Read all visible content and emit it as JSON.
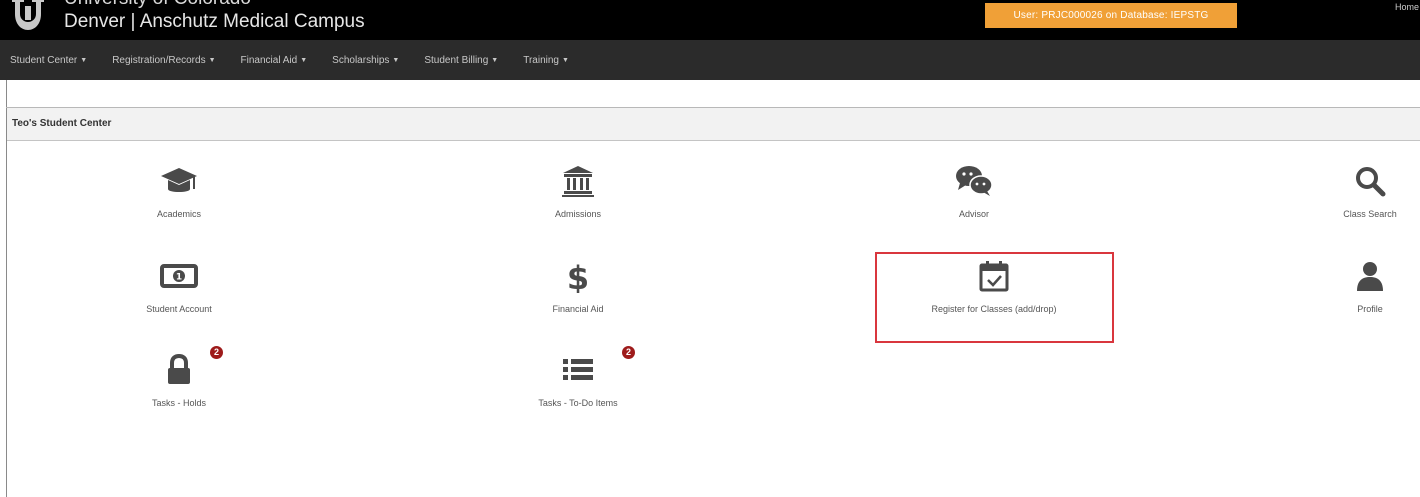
{
  "header": {
    "university_line1": "University of Colorado",
    "university_line2": "Denver | Anschutz Medical Campus",
    "user_badge": "User: PRJC000026 on Database: IEPSTG",
    "home_link": "Home"
  },
  "nav": {
    "items": [
      {
        "label": "Student Center"
      },
      {
        "label": "Registration/Records"
      },
      {
        "label": "Financial Aid"
      },
      {
        "label": "Scholarships"
      },
      {
        "label": "Student Billing"
      },
      {
        "label": "Training"
      }
    ]
  },
  "section": {
    "title": "Teo's Student Center"
  },
  "tiles": {
    "academics": {
      "label": "Academics",
      "icon": "graduation-cap-icon"
    },
    "admissions": {
      "label": "Admissions",
      "icon": "institution-icon"
    },
    "advisor": {
      "label": "Advisor",
      "icon": "chat-bubbles-icon"
    },
    "class_search": {
      "label": "Class Search",
      "icon": "search-icon"
    },
    "student_account": {
      "label": "Student Account",
      "icon": "money-icon"
    },
    "financial_aid": {
      "label": "Financial Aid",
      "icon": "dollar-icon"
    },
    "register": {
      "label": "Register for Classes (add/drop)",
      "icon": "calendar-check-icon"
    },
    "profile": {
      "label": "Profile",
      "icon": "user-icon"
    },
    "tasks_holds": {
      "label": "Tasks - Holds",
      "icon": "lock-icon",
      "badge": "2"
    },
    "tasks_todo": {
      "label": "Tasks - To-Do Items",
      "icon": "list-icon",
      "badge": "2"
    }
  },
  "colors": {
    "header_bg": "#000000",
    "nav_bg": "#2b2b2b",
    "user_badge_bg": "#f0a037",
    "icon": "#4a4a4a",
    "badge_bg": "#9e1b1b",
    "highlight": "#d9363e"
  }
}
